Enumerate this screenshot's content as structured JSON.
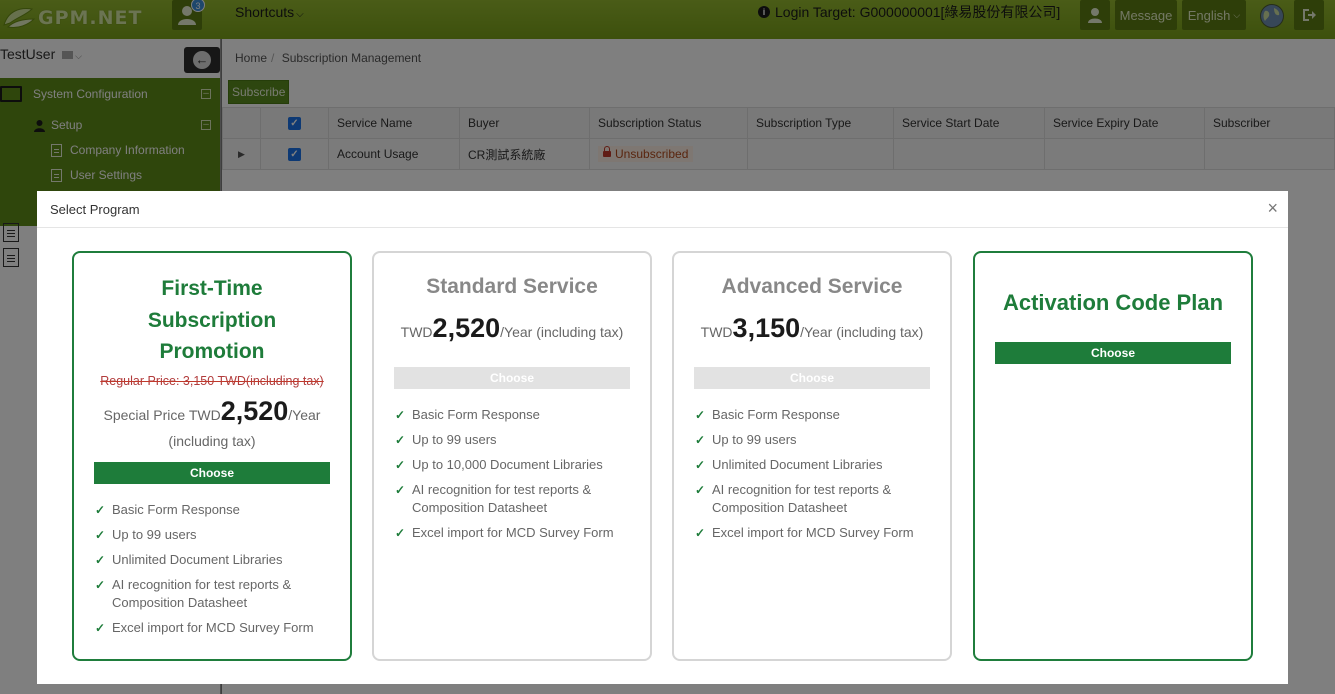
{
  "topbar": {
    "logo_text": "GPM.NET",
    "notification_count": "3",
    "shortcuts_label": "Shortcuts",
    "login_target": "Login Target: G000000001[綠易股份有限公司]",
    "message_label": "Message",
    "language_label": "English"
  },
  "sidebar": {
    "username": "TestUser",
    "menu": {
      "system_configuration": "System Configuration",
      "setup": "Setup",
      "company_information": "Company Information",
      "user_settings": "User Settings"
    }
  },
  "breadcrumb": {
    "home": "Home",
    "current": "Subscription Management"
  },
  "toolbar": {
    "subscribe_label": "Subscribe"
  },
  "grid": {
    "columns": [
      "Service Name",
      "Buyer",
      "Subscription Status",
      "Subscription Type",
      "Service Start Date",
      "Service Expiry Date",
      "Subscriber"
    ],
    "rows": [
      {
        "service_name": "Account Usage",
        "buyer": "CR測試系統廠",
        "status": "Unsubscribed",
        "type": "",
        "start": "",
        "expiry": "",
        "subscriber": ""
      }
    ]
  },
  "modal": {
    "title": "Select Program",
    "close": "×",
    "plans": [
      {
        "title_lines": [
          "First-Time",
          "Subscription",
          "Promotion"
        ],
        "regular_price": "Regular Price: 3,150 TWD(including tax)",
        "special_prefix": "Special Price TWD",
        "price": "2,520",
        "suffix": "/Year",
        "suffix2": "(including tax)",
        "choose_label": "Choose",
        "features": [
          "Basic Form Response",
          "Up to 99 users",
          "Unlimited Document Libraries",
          "AI recognition for test reports & Composition Datasheet",
          "Excel import for MCD Survey Form"
        ]
      },
      {
        "title": "Standard Service",
        "currency": "TWD",
        "price": "2,520",
        "suffix": "/Year (including tax)",
        "choose_label": "Choose",
        "features": [
          "Basic Form Response",
          "Up to 99 users",
          "Up to 10,000 Document Libraries",
          "AI recognition for test reports & Composition Datasheet",
          "Excel import for MCD Survey Form"
        ]
      },
      {
        "title": "Advanced Service",
        "currency": "TWD",
        "price": "3,150",
        "suffix": "/Year (including tax)",
        "choose_label": "Choose",
        "features": [
          "Basic Form Response",
          "Up to 99 users",
          "Unlimited Document Libraries",
          "AI recognition for test reports & Composition Datasheet",
          "Excel import for MCD Survey Form"
        ]
      },
      {
        "title": "Activation Code Plan",
        "choose_label": "Choose"
      }
    ]
  },
  "colors": {
    "topbar": "#8bb028",
    "sidebar_menu": "#5f8c19",
    "plan_green": "#1e7c3a",
    "disabled": "#e2e2e2"
  }
}
